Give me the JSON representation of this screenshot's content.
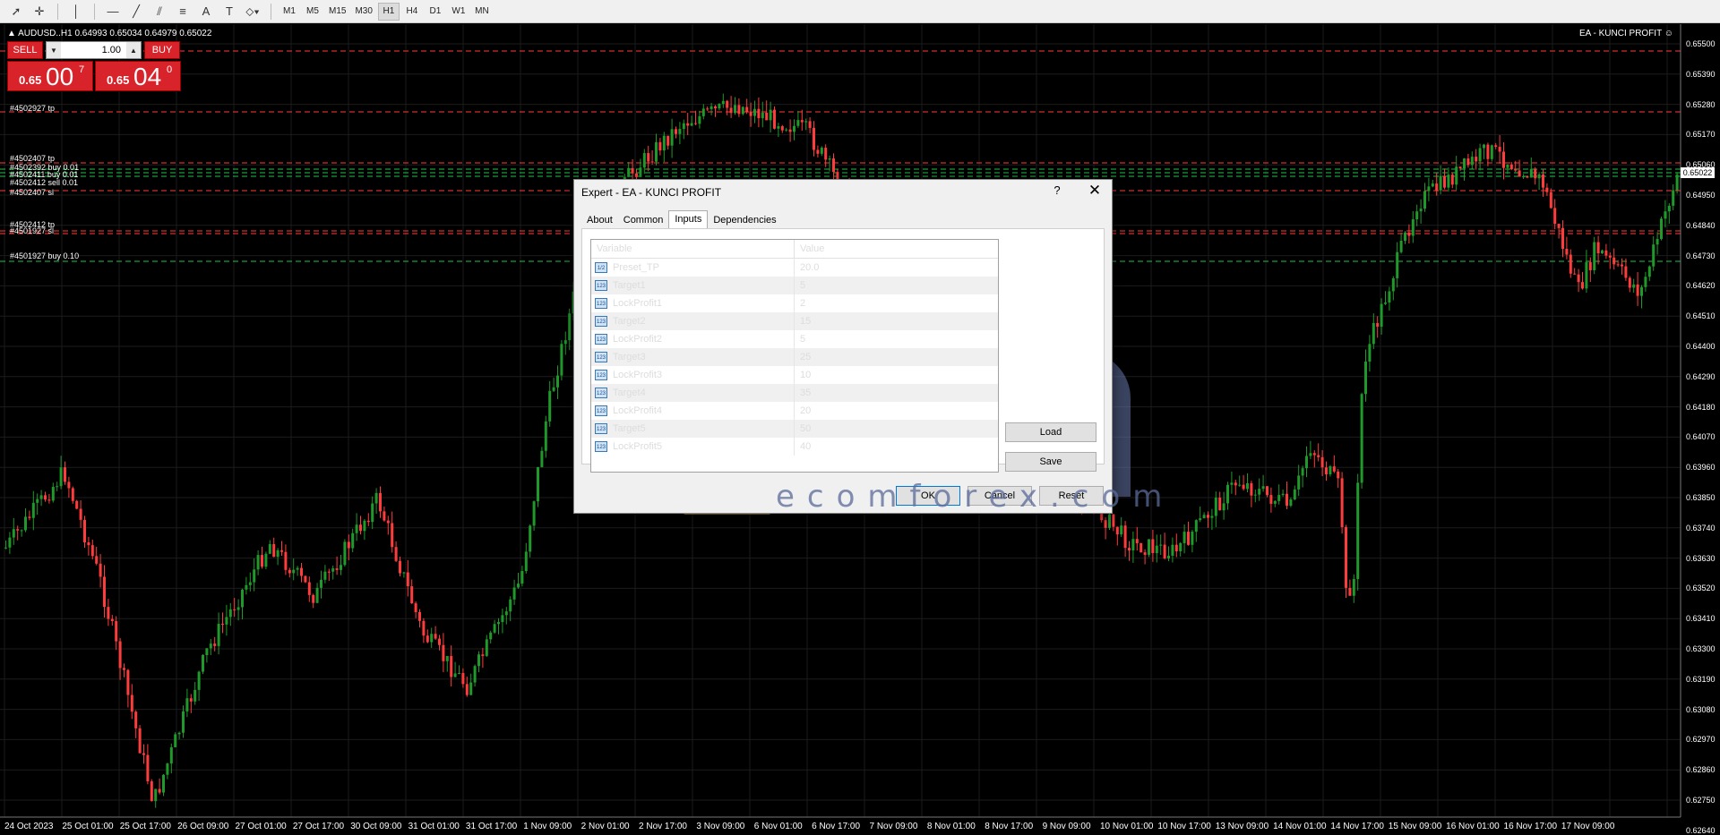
{
  "toolbar": {
    "timeframes": [
      "M1",
      "M5",
      "M15",
      "M30",
      "H1",
      "H4",
      "D1",
      "W1",
      "MN"
    ],
    "active_timeframe": "H1",
    "tool_icons": [
      "cursor-icon",
      "crosshair-icon",
      "vertical-line-icon",
      "horizontal-line-icon",
      "trendline-icon",
      "channel-icon",
      "fibonacci-icon",
      "text-icon",
      "text-label-icon",
      "shapes-icon"
    ]
  },
  "chart": {
    "symbol_line": "▲ AUDUSD..H1  0.64993 0.65034 0.64979 0.65022",
    "ea_name": "EA - KUNCI PROFIT ☺",
    "current_price": "0.65022",
    "bull_color": "#1f9a2a",
    "bear_color": "#ff3c3c"
  },
  "oneclick": {
    "sell_label": "SELL",
    "buy_label": "BUY",
    "lot": "1.00",
    "sell_small": "0.65",
    "sell_big": "00",
    "sell_sup": "7",
    "buy_small": "0.65",
    "buy_big": "04",
    "buy_sup": "0"
  },
  "order_labels": [
    "#4502927 tp",
    "#4502407 tp",
    "#4502392 buy 0.01",
    "#4502411 buy 0.01",
    "#4502412 sell 0.01",
    "#4502407 sl",
    "#4502412 tp",
    "#4501927 sl",
    "#4501927 buy 0.10"
  ],
  "price_axis": [
    "0.65500",
    "0.65390",
    "0.65280",
    "0.65170",
    "0.65060",
    "0.64950",
    "0.64840",
    "0.64730",
    "0.64620",
    "0.64510",
    "0.64400",
    "0.64290",
    "0.64180",
    "0.64070",
    "0.63960",
    "0.63850",
    "0.63740",
    "0.63630",
    "0.63520",
    "0.63410",
    "0.63300",
    "0.63190",
    "0.63080",
    "0.62970",
    "0.62860",
    "0.62750",
    "0.62640"
  ],
  "date_axis": [
    "24 Oct 2023",
    "25 Oct 01:00",
    "25 Oct 17:00",
    "26 Oct 09:00",
    "27 Oct 01:00",
    "27 Oct 17:00",
    "30 Oct 09:00",
    "31 Oct 01:00",
    "31 Oct 17:00",
    "1 Nov 09:00",
    "2 Nov 01:00",
    "2 Nov 17:00",
    "3 Nov 09:00",
    "6 Nov 01:00",
    "6 Nov 17:00",
    "7 Nov 09:00",
    "8 Nov 01:00",
    "8 Nov 17:00",
    "9 Nov 09:00",
    "10 Nov 01:00",
    "10 Nov 17:00",
    "13 Nov 09:00",
    "14 Nov 01:00",
    "14 Nov 17:00",
    "15 Nov 09:00",
    "16 Nov 01:00",
    "16 Nov 17:00",
    "17 Nov 09:00"
  ],
  "dialog": {
    "title": "Expert - EA - KUNCI PROFIT",
    "help": "?",
    "close": "✕",
    "tabs": [
      "About",
      "Common",
      "Inputs",
      "Dependencies"
    ],
    "active_tab": "Inputs",
    "col_variable": "Variable",
    "col_value": "Value",
    "inputs": [
      {
        "type": "1/2",
        "name": "Preset_TP",
        "value": "20.0"
      },
      {
        "type": "123",
        "name": "Target1",
        "value": "5"
      },
      {
        "type": "123",
        "name": "LockProfit1",
        "value": "2"
      },
      {
        "type": "123",
        "name": "Target2",
        "value": "15"
      },
      {
        "type": "123",
        "name": "LockProfit2",
        "value": "5"
      },
      {
        "type": "123",
        "name": "Target3",
        "value": "25"
      },
      {
        "type": "123",
        "name": "LockProfit3",
        "value": "10"
      },
      {
        "type": "123",
        "name": "Target4",
        "value": "35"
      },
      {
        "type": "123",
        "name": "LockProfit4",
        "value": "20"
      },
      {
        "type": "123",
        "name": "Target5",
        "value": "50"
      },
      {
        "type": "123",
        "name": "LockProfit5",
        "value": "40"
      }
    ],
    "load": "Load",
    "save": "Save",
    "ok": "OK",
    "cancel": "Cancel",
    "reset": "Reset"
  },
  "watermark": {
    "text": "ecomforex.com"
  }
}
